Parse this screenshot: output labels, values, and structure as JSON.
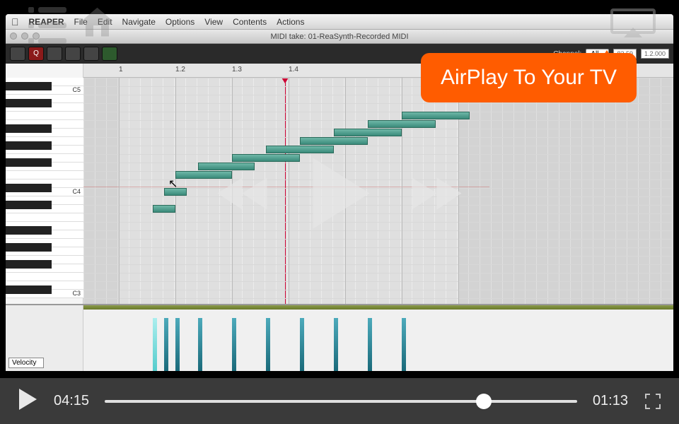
{
  "menubar": {
    "app": "REAPER",
    "items": [
      "File",
      "Edit",
      "Navigate",
      "Options",
      "View",
      "Contents",
      "Actions"
    ]
  },
  "window": {
    "title": "MIDI take: 01-ReaSynth-Recorded MIDI"
  },
  "toolbar": {
    "channel_label": "Channel:",
    "channel_value": "All",
    "pos1": "83 59",
    "pos2": "1.2.000",
    "q_label": "Q"
  },
  "ruler": {
    "marks": [
      "1",
      "1.2",
      "1.3",
      "1.4"
    ]
  },
  "piano": {
    "oct_labels": [
      "C5",
      "C4",
      "C3"
    ]
  },
  "velocity": {
    "label": "Velocity"
  },
  "tooltip": {
    "text": "AirPlay To Your TV"
  },
  "player": {
    "current": "04:15",
    "remaining": "01:13",
    "progress_pct": 77
  },
  "chart_data": {
    "type": "table",
    "description": "MIDI note events in piano roll (ascending phrase)",
    "notes": [
      {
        "start_beat": 1.15,
        "pitch_row": 15,
        "len_beats": 0.1
      },
      {
        "start_beat": 1.2,
        "pitch_row": 13,
        "len_beats": 0.1
      },
      {
        "start_beat": 1.25,
        "pitch_row": 11,
        "len_beats": 0.25
      },
      {
        "start_beat": 1.35,
        "pitch_row": 10,
        "len_beats": 0.25
      },
      {
        "start_beat": 1.5,
        "pitch_row": 9,
        "len_beats": 0.3
      },
      {
        "start_beat": 1.65,
        "pitch_row": 8,
        "len_beats": 0.3
      },
      {
        "start_beat": 1.8,
        "pitch_row": 7,
        "len_beats": 0.3
      },
      {
        "start_beat": 1.95,
        "pitch_row": 6,
        "len_beats": 0.3
      },
      {
        "start_beat": 2.1,
        "pitch_row": 5,
        "len_beats": 0.3
      },
      {
        "start_beat": 2.25,
        "pitch_row": 4,
        "len_beats": 0.3
      }
    ],
    "velocities": [
      {
        "beat": 1.15,
        "v": 100,
        "hl": true
      },
      {
        "beat": 1.2,
        "v": 100
      },
      {
        "beat": 1.25,
        "v": 100
      },
      {
        "beat": 1.35,
        "v": 100
      },
      {
        "beat": 1.5,
        "v": 100
      },
      {
        "beat": 1.65,
        "v": 100
      },
      {
        "beat": 1.8,
        "v": 100
      },
      {
        "beat": 1.95,
        "v": 100
      },
      {
        "beat": 2.1,
        "v": 100
      },
      {
        "beat": 2.25,
        "v": 100
      }
    ]
  }
}
